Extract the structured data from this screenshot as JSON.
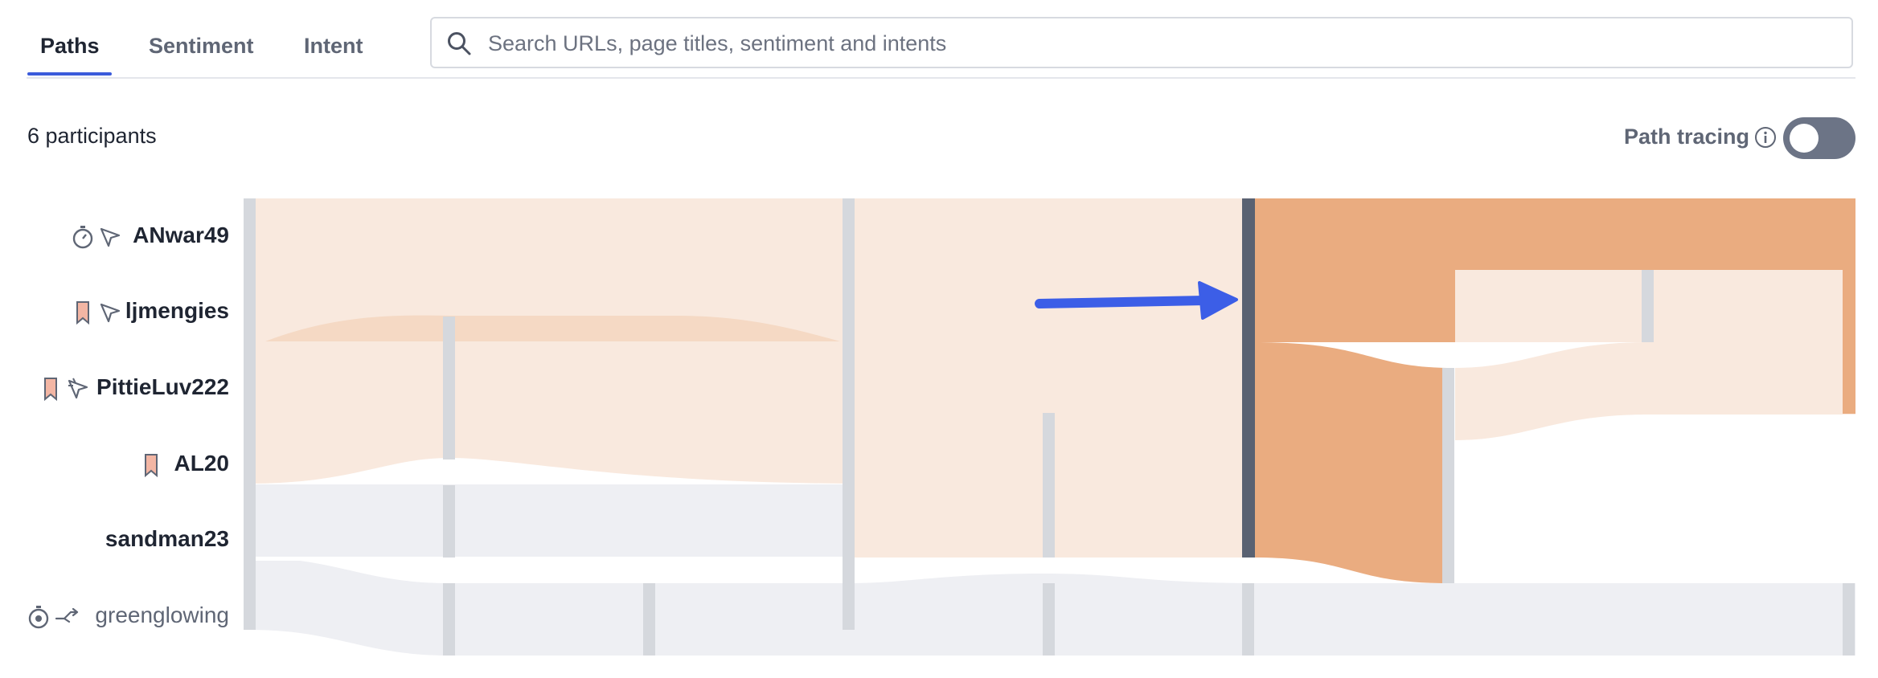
{
  "tabs": [
    {
      "label": "Paths",
      "active": true
    },
    {
      "label": "Sentiment",
      "active": false
    },
    {
      "label": "Intent",
      "active": false
    }
  ],
  "search": {
    "placeholder": "Search URLs, page titles, sentiment and intents",
    "value": ""
  },
  "participants_count": "6 participants",
  "path_tracing": {
    "label": "Path tracing",
    "enabled": false
  },
  "participants": [
    {
      "name": "ANwar49",
      "icons": [
        "stopwatch-icon",
        "cursor-arrow-icon"
      ]
    },
    {
      "name": "ljmengies",
      "icons": [
        "bookmark-icon",
        "cursor-arrow-icon"
      ]
    },
    {
      "name": "PittieLuv222",
      "icons": [
        "bookmark-icon",
        "multi-click-icon"
      ]
    },
    {
      "name": "AL20",
      "icons": [
        "bookmark-icon"
      ]
    },
    {
      "name": "sandman23",
      "icons": []
    },
    {
      "name": "greenglowing",
      "icons": [
        "stopwatch-icon",
        "branch-arrow-icon"
      ]
    }
  ],
  "colors": {
    "accent": "#3b5bdb",
    "flow_light": "#f9e9de",
    "flow_highlight": "#eaac80",
    "flow_grey": "#eeeff3",
    "node": "#d5d8dd",
    "node_selected": "#5a6272",
    "arrow": "#3c5ee7"
  }
}
